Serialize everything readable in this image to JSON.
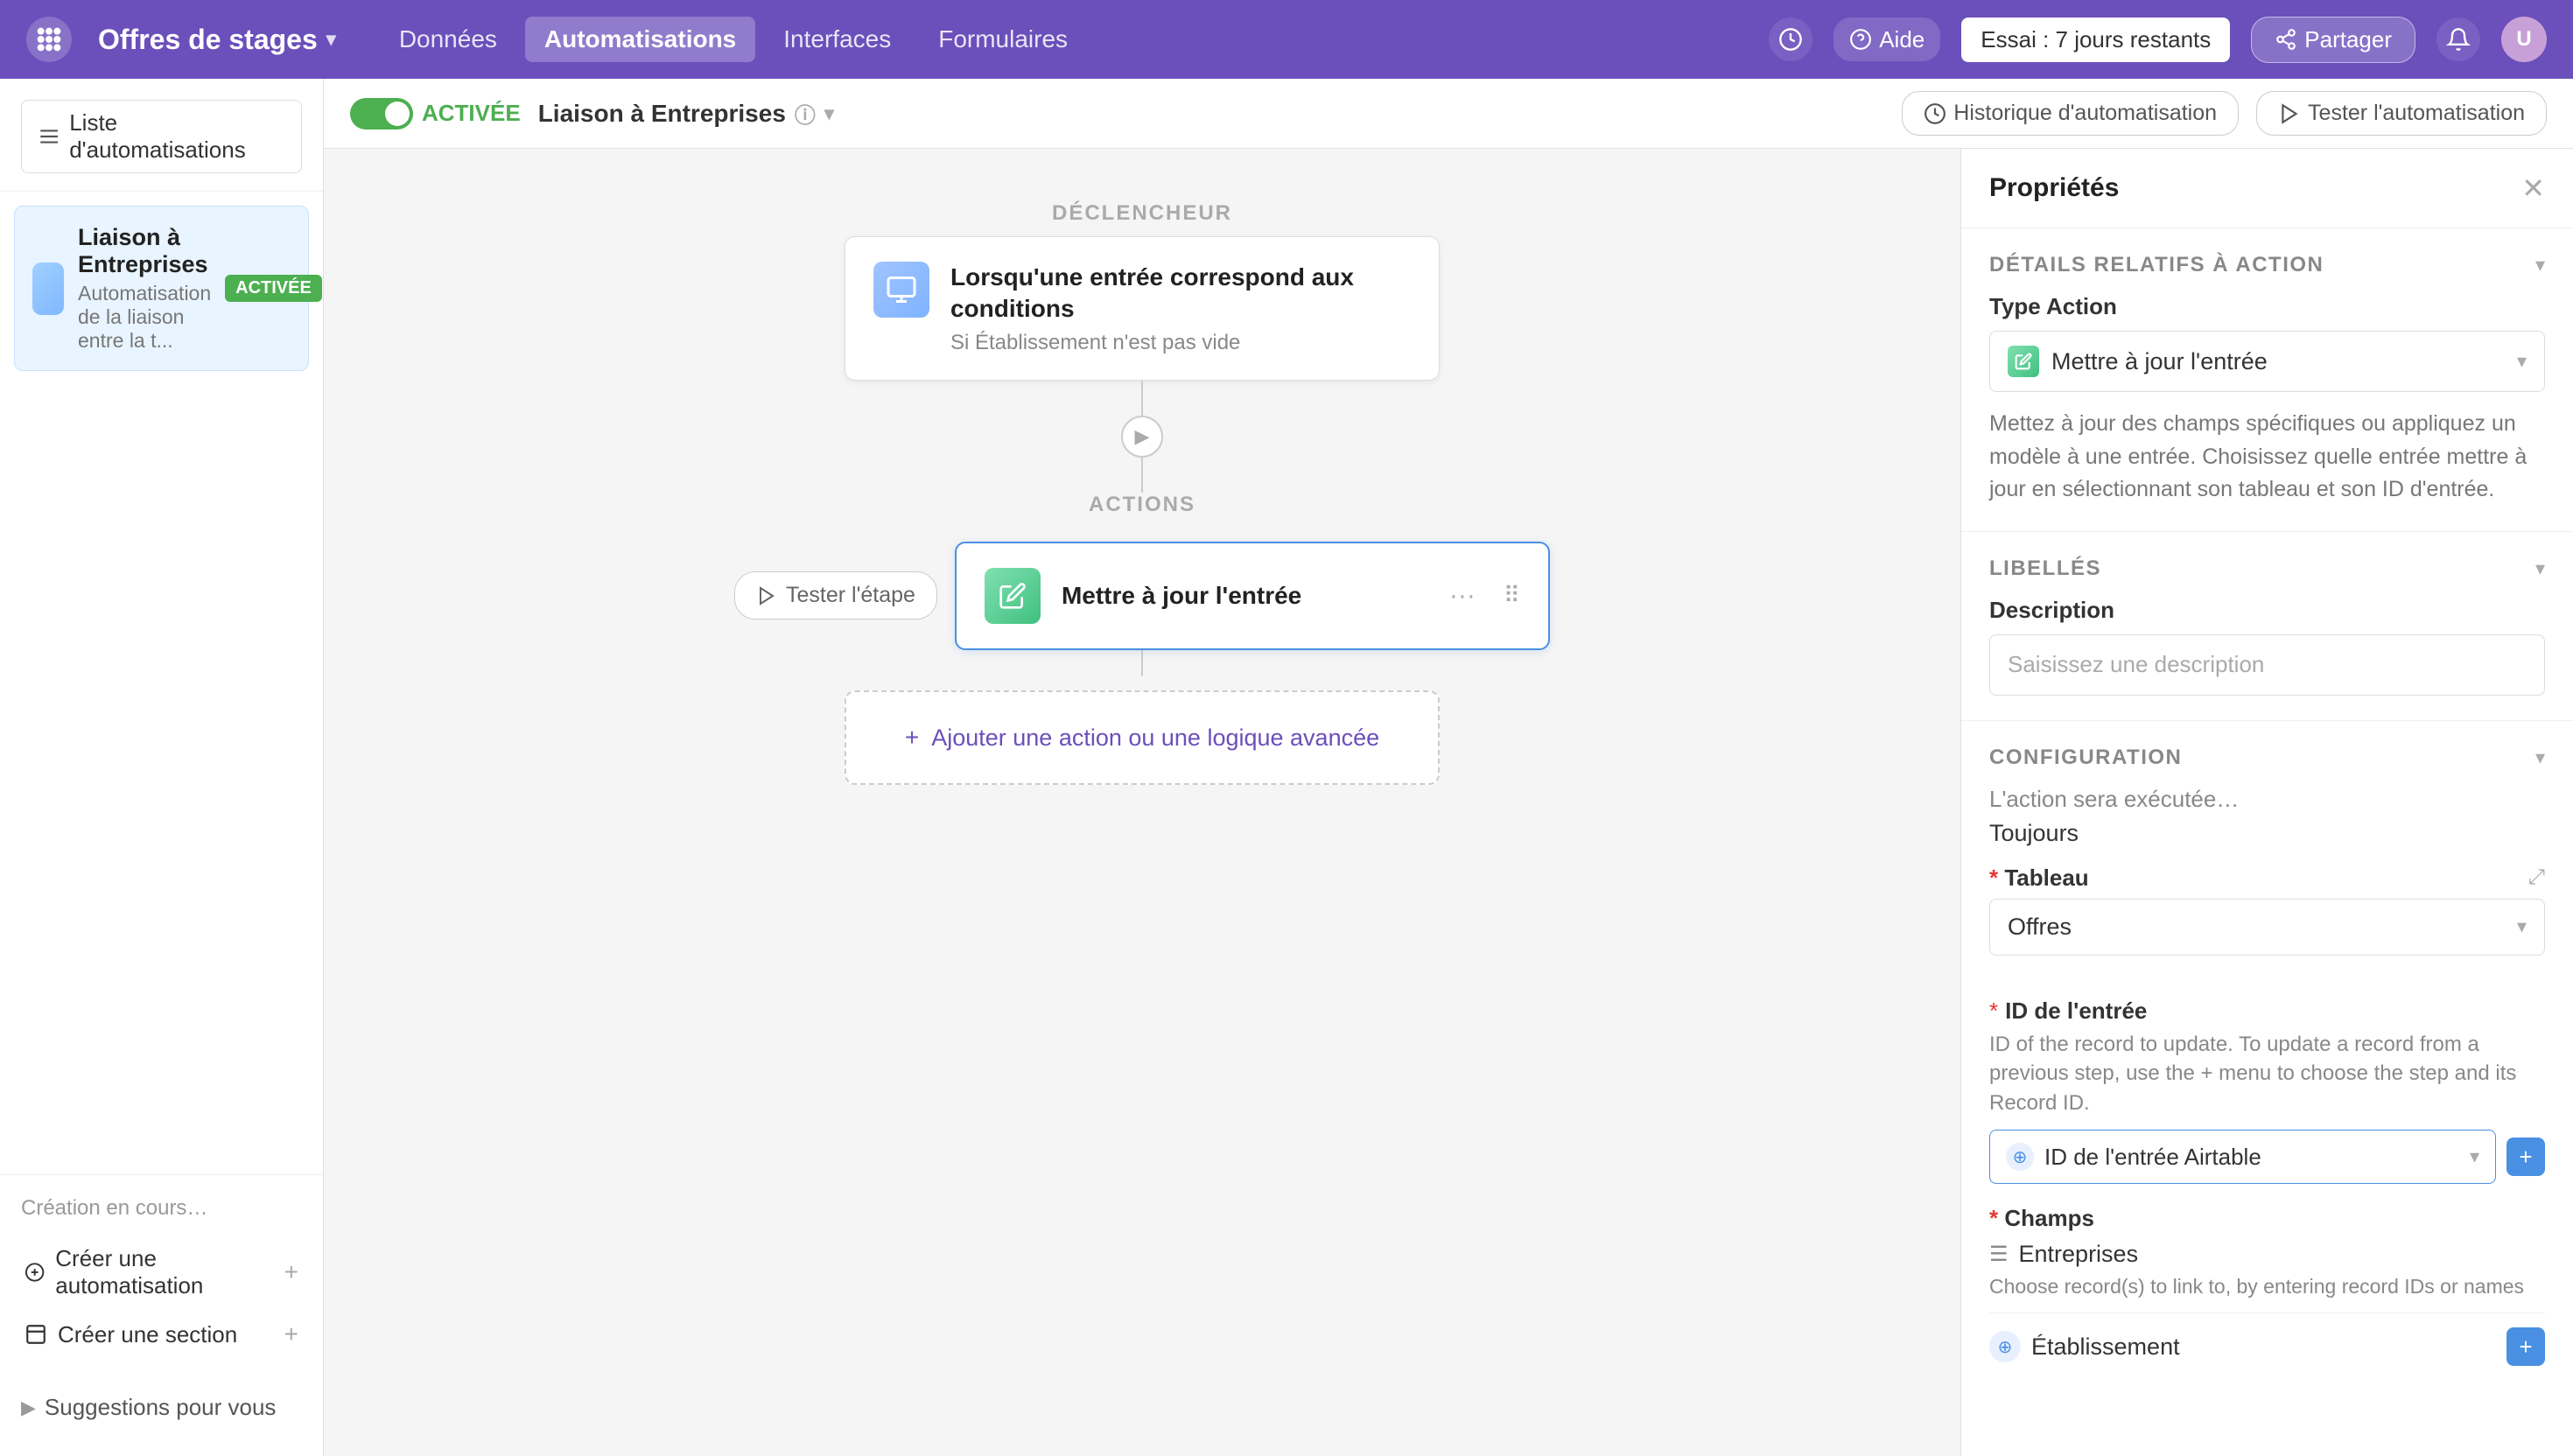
{
  "nav": {
    "logo_icon": "grid-icon",
    "app_name": "Offres de stages",
    "links": [
      {
        "id": "donnees",
        "label": "Données",
        "active": false
      },
      {
        "id": "automatisations",
        "label": "Automatisations",
        "active": true
      },
      {
        "id": "interfaces",
        "label": "Interfaces",
        "active": false
      },
      {
        "id": "formulaires",
        "label": "Formulaires",
        "active": false
      }
    ],
    "history_icon": "history-icon",
    "help_label": "Aide",
    "trial_label": "Essai : 7 jours restants",
    "share_label": "Partager",
    "notifications_icon": "bell-icon",
    "avatar_label": "U"
  },
  "sidebar": {
    "list_button_label": "Liste d'automatisations",
    "automation_item": {
      "name": "Liaison à Entreprises",
      "description": "Automatisation de la liaison entre la t...",
      "badge": "ACTIVÉE"
    },
    "footer": {
      "creation_label": "Création en cours…",
      "create_automation_label": "Créer une automatisation",
      "create_section_label": "Créer une section",
      "suggestions_label": "Suggestions pour vous"
    }
  },
  "sub_header": {
    "active_badge": "ACTIVÉE",
    "automation_title": "Liaison à Entreprises",
    "history_btn": "Historique d'automatisation",
    "test_btn": "Tester l'automatisation"
  },
  "canvas": {
    "trigger_label": "DÉCLENCHEUR",
    "actions_label": "ACTIONS",
    "trigger_title": "Lorsqu'une entrée correspond aux conditions",
    "trigger_sub": "Si Établissement n'est pas vide",
    "action_title": "Mettre à jour l'entrée",
    "test_step_label": "Tester l'étape",
    "add_action_label": "Ajouter une action ou une logique avancée"
  },
  "right_panel": {
    "title": "Propriétés",
    "section_action": "DÉTAILS RELATIFS À ACTION",
    "type_action_label": "Type Action",
    "type_action_value": "Mettre à jour l'entrée",
    "type_action_description": "Mettez à jour des champs spécifiques ou appliquez un modèle à une entrée. Choisissez quelle entrée mettre à jour en sélectionnant son tableau et son ID d'entrée.",
    "section_labels": "LIBELLÉS",
    "description_label": "Description",
    "description_placeholder": "Saisissez une description",
    "section_config": "CONFIGURATION",
    "executed_label": "L'action sera exécutée…",
    "executed_value": "Toujours",
    "tableau_label": "Tableau",
    "tableau_value": "Offres",
    "id_label": "ID de l'entrée",
    "id_description": "ID of the record to update. To update a record from a previous step, use the + menu to choose the step and its Record ID.",
    "id_value": "ID de l'entrée Airtable",
    "champs_label": "Champs",
    "champs_item": "Entreprises",
    "champs_sub": "Choose record(s) to link to, by entering record IDs or names",
    "etablissement_label": "Établissement"
  }
}
